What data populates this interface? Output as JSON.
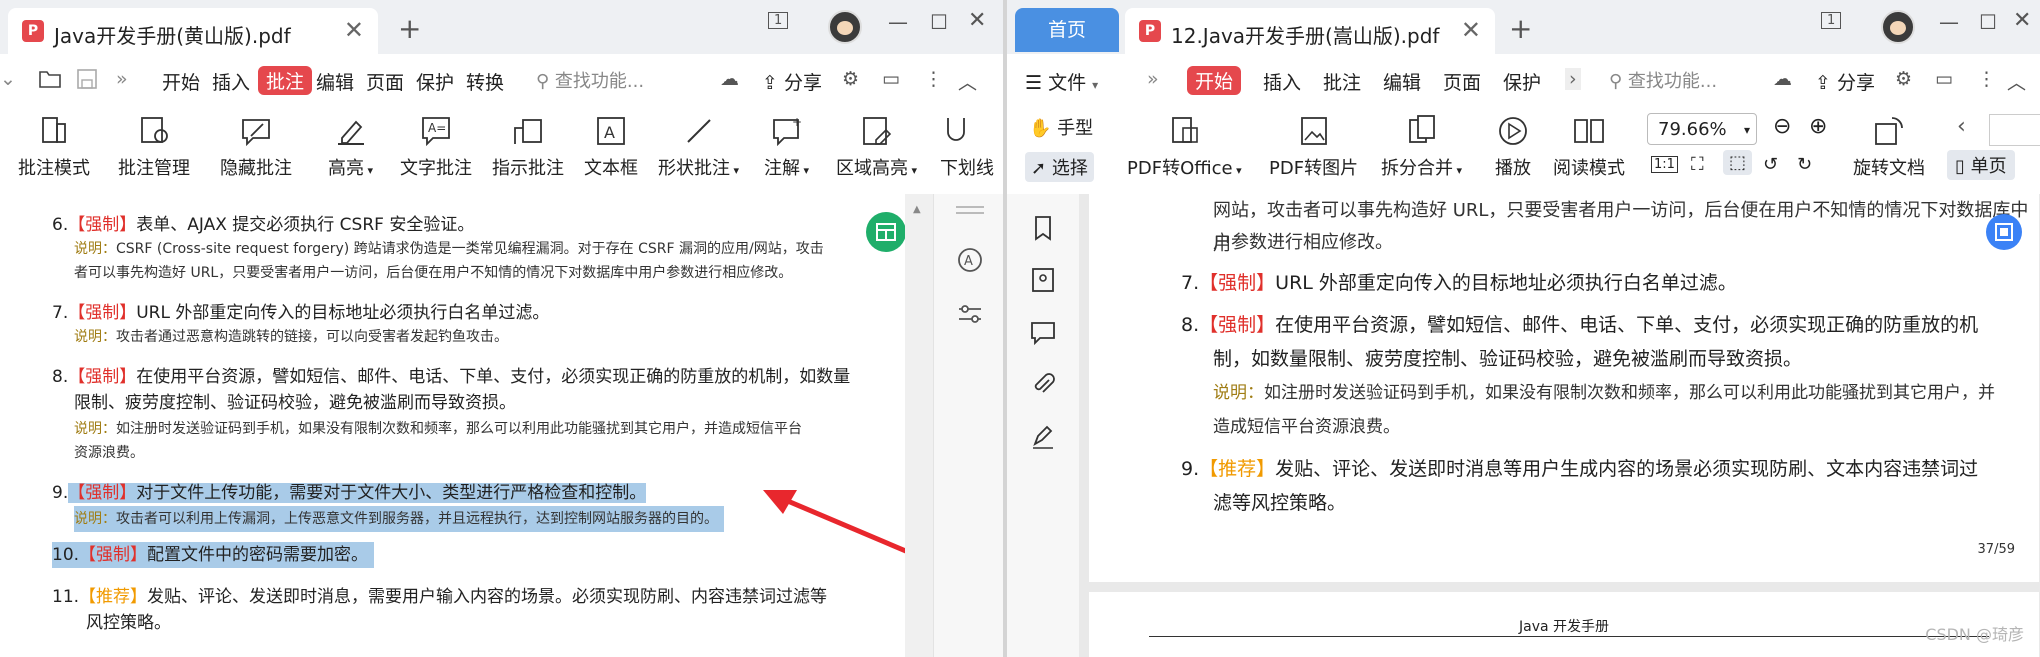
{
  "left": {
    "tab_title": "Java开发手册(黄山版).pdf",
    "tab_close": "✕",
    "new_tab": "+",
    "menu": [
      "开始",
      "插入",
      "批注",
      "编辑",
      "页面",
      "保护",
      "转换"
    ],
    "active_menu": "批注",
    "search_text": "查找功能...",
    "share": "分享",
    "toolbar": [
      "批注模式",
      "批注管理",
      "隐藏批注",
      "高亮",
      "文字批注",
      "指示批注",
      "文本框",
      "形状批注",
      "注解",
      "区域高亮",
      "下划线"
    ],
    "items": [
      {
        "num": "6.",
        "tag": "【强制】",
        "text": "表单、AJAX 提交必须执行 CSRF 安全验证。",
        "note_label": "说明：",
        "note": "CSRF (Cross-site request forgery) 跨站请求伪造是一类常见编程漏洞。对于存在 CSRF 漏洞的应用/网站，攻击",
        "note2": "者可以事先构造好 URL，只要受害者用户一访问，后台便在用户不知情的情况下对数据库中用户参数进行相应修改。"
      },
      {
        "num": "7.",
        "tag": "【强制】",
        "text": "URL 外部重定向传入的目标地址必须执行白名单过滤。",
        "note_label": "说明：",
        "note": "攻击者通过恶意构造跳转的链接，可以向受害者发起钓鱼攻击。"
      },
      {
        "num": "8.",
        "tag": "【强制】",
        "text": "在使用平台资源，譬如短信、邮件、电话、下单、支付，必须实现正确的防重放的机制，如数量",
        "text2": "限制、疲劳度控制、验证码校验，避免被滥刷而导致资损。",
        "note_label": "说明：",
        "note": "如注册时发送验证码到手机，如果没有限制次数和频率，那么可以利用此功能骚扰到其它用户，并造成短信平台",
        "note2": "资源浪费。"
      },
      {
        "num": "9.",
        "tag": "【强制】",
        "text": "对于文件上传功能，需要对于文件大小、类型进行严格检查和控制。",
        "note_label": "说明：",
        "note": "攻击者可以利用上传漏洞，上传恶意文件到服务器，并且远程执行，达到控制网站服务器的目的。"
      },
      {
        "num": "10.",
        "tag": "【强制】",
        "text": "配置文件中的密码需要加密。"
      },
      {
        "num": "11.",
        "tag": "【推荐】",
        "text": "发贴、评论、发送即时消息，需要用户输入内容的场景。必须实现防刷、内容违禁词过滤等",
        "text2": "风控策略。"
      }
    ]
  },
  "right": {
    "home_tab": "首页",
    "tab_title": "12.Java开发手册(嵩山版).pdf",
    "tab_close": "✕",
    "new_tab": "+",
    "file_menu": "文件",
    "menu": [
      "开始",
      "插入",
      "批注",
      "编辑",
      "页面",
      "保护"
    ],
    "active_menu": "开始",
    "search_text": "查找功能...",
    "share": "分享",
    "hand_tool": "手型",
    "select_tool": "选择",
    "toolbar": [
      "PDF转Office",
      "PDF转图片",
      "拆分合并",
      "播放",
      "阅读模式"
    ],
    "zoom": "79.66%",
    "rotate": "旋转文档",
    "single_page": "单页",
    "lines": [
      "网站，攻击者可以事先构造好 URL，只要受害者用户一访问，后台便在用户不知情的情况下对数据库中用",
      "户参数进行相应修改。"
    ],
    "items": [
      {
        "num": "7.",
        "tag": "【强制】",
        "text": "URL 外部重定向传入的目标地址必须执行白名单过滤。"
      },
      {
        "num": "8.",
        "tag": "【强制】",
        "text": "在使用平台资源，譬如短信、邮件、电话、下单、支付，必须实现正确的防重放的机",
        "text2": "制，如数量限制、疲劳度控制、验证码校验，避免被滥刷而导致资损。",
        "note_label": "说明：",
        "note": "如注册时发送验证码到手机，如果没有限制次数和频率，那么可以利用此功能骚扰到其它用户，并",
        "note2": "造成短信平台资源浪费。"
      },
      {
        "num": "9.",
        "tag": "【推荐】",
        "text": "发贴、评论、发送即时消息等用户生成内容的场景必须实现防刷、文本内容违禁词过",
        "text2": "滤等风控策略。"
      }
    ],
    "page_number": "37/59",
    "next_header": "Java 开发手册",
    "watermark": "CSDN @琦彦"
  },
  "colors": {
    "accent_red": "#e0302b",
    "recommend_orange": "#f19a00",
    "highlight": "#a9cbe8",
    "arrow": "#e8272d",
    "home_blue": "#4a90e2"
  }
}
